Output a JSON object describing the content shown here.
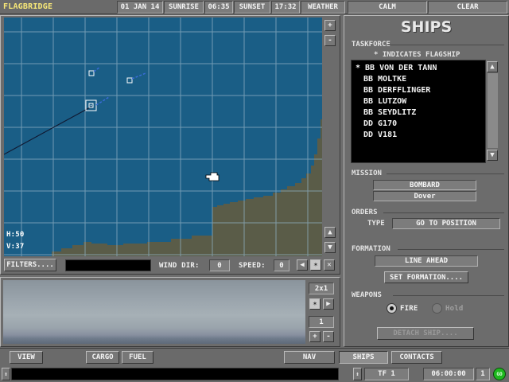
{
  "topbar": {
    "title": "FLAGBRIDGE",
    "date": "01 JAN 14",
    "sunrise_label": "SUNRISE",
    "sunrise_time": "06:35",
    "sunset_label": "SUNSET",
    "sunset_time": "17:32",
    "weather_label": "WEATHER",
    "sea": "CALM",
    "sky": "CLEAR"
  },
  "map": {
    "h_readout": "H:50",
    "v_readout": "V:37",
    "zoom_in": "+",
    "zoom_out": "-",
    "filters_label": "FILTERS....",
    "wind_label": "WIND DIR:",
    "wind_value": "0",
    "speed_label": "SPEED:",
    "speed_value": "0",
    "colors": {
      "sea": "#1a5e86",
      "land": "#5a5c48",
      "grid": "#8fb0c4"
    }
  },
  "viewport": {
    "magnification": "2x1",
    "page_value": "1"
  },
  "ships_panel": {
    "heading": "SHIPS",
    "taskforce_label": "TASKFORCE",
    "flagship_note": "* INDICATES FLAGSHIP",
    "ships": [
      "* BB VON DER TANN",
      "BB MOLTKE",
      "BB DERFFLINGER",
      "BB LUTZOW",
      "BB SEYDLITZ",
      "DD G170",
      "DD V181"
    ],
    "mission_label": "MISSION",
    "mission_type": "BOMBARD",
    "mission_target": "Dover",
    "orders_label": "ORDERS",
    "type_label": "TYPE",
    "order_value": "GO TO POSITION",
    "formation_label": "FORMATION",
    "formation_value": "LINE AHEAD",
    "set_formation_label": "SET FORMATION....",
    "weapons_label": "WEAPONS",
    "fire_label": "FIRE",
    "hold_label": "Hold",
    "detach_label": "DETACH SHIP...."
  },
  "bottombar": {
    "view_label": "VIEW",
    "cargo_label": "CARGO",
    "fuel_label": "FUEL",
    "nav_label": "NAV",
    "ships_label": "SHIPS",
    "contacts_label": "CONTACTS",
    "taskforce_id": "TF 1",
    "clock": "06:00:00",
    "speed_multiplier": "1",
    "go_label": "GO"
  }
}
